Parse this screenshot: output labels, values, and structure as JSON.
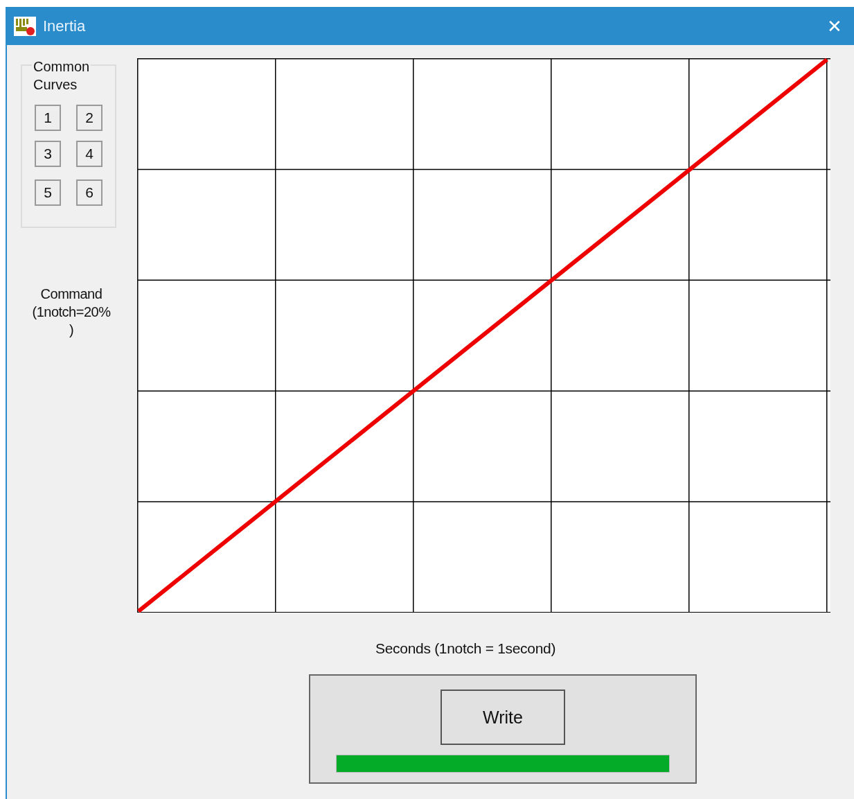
{
  "window": {
    "title": "Inertia",
    "close": "✕"
  },
  "common_curves": {
    "title": "Common\nCurves",
    "buttons": [
      "1",
      "2",
      "3",
      "4",
      "5",
      "6"
    ]
  },
  "y_axis_label": "Command\n(1notch=20%\n)",
  "x_axis_label": "Seconds (1notch = 1second)",
  "write_panel": {
    "button": "Write",
    "progress": {
      "level": 1
    }
  }
}
